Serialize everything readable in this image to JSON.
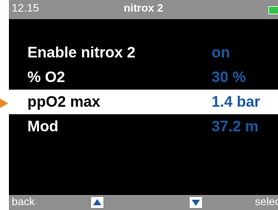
{
  "status_bar": {
    "time": "12.15",
    "title": "nitrox 2",
    "battery_icon": "battery-full-icon",
    "battery_color": "#33c24a"
  },
  "settings": [
    {
      "label": "Enable nitrox 2",
      "value": "on",
      "selected": false
    },
    {
      "label": "% O2",
      "value": "30 %",
      "selected": false
    },
    {
      "label": "ppO2 max",
      "value": "1.4 bar",
      "selected": true
    },
    {
      "label": "Mod",
      "value": "37.2 m",
      "selected": false
    }
  ],
  "softkeys": {
    "back": "back",
    "up_icon": "arrow-up-icon",
    "down_icon": "arrow-down-icon",
    "select": "select"
  },
  "colors": {
    "value_blue": "#1a5aa6",
    "bar_gray": "#8f8f8f",
    "pointer_orange": "#f08a24"
  }
}
